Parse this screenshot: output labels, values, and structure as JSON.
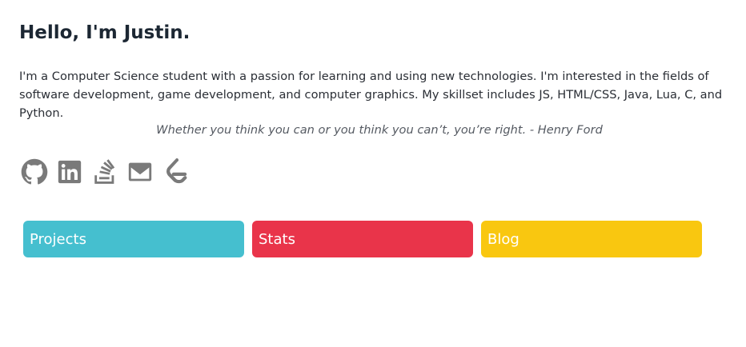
{
  "header": {
    "title": "Hello, I'm Justin."
  },
  "intro": {
    "text": "I'm a Computer Science student with a passion for learning and using new technologies. I'm interested in the fields of software development, game development, and computer graphics. My skillset includes JS, HTML/CSS, Java, Lua, C, and Python."
  },
  "quote": {
    "text": "Whether you think you can or you think you can’t, you’re right. - Henry Ford"
  },
  "social_icons": [
    {
      "name": "github-icon"
    },
    {
      "name": "linkedin-icon"
    },
    {
      "name": "stackoverflow-icon"
    },
    {
      "name": "email-icon"
    },
    {
      "name": "leetcode-icon"
    }
  ],
  "icon_color": "#7a7a7a",
  "cards": [
    {
      "label": "Projects",
      "color": "#45bfcf"
    },
    {
      "label": "Stats",
      "color": "#e9344a"
    },
    {
      "label": "Blog",
      "color": "#f9c710"
    }
  ]
}
